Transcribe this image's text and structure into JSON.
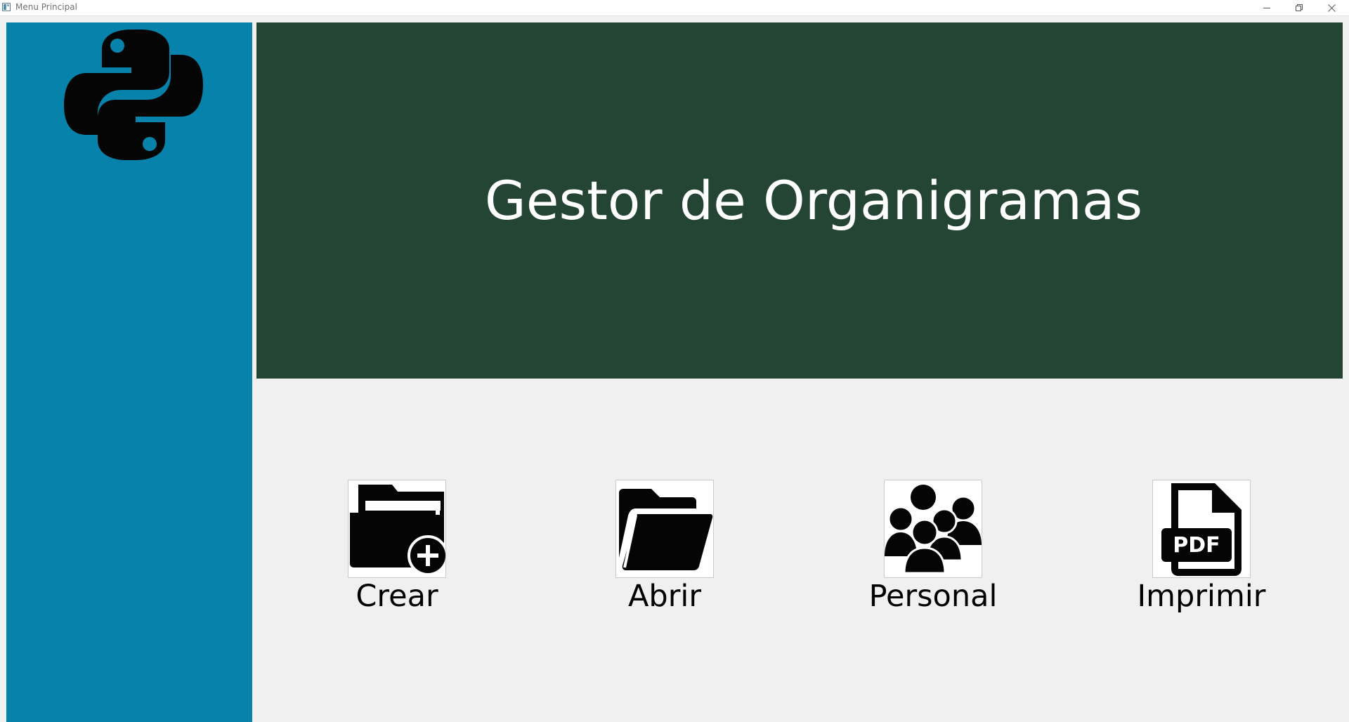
{
  "window": {
    "title": "Menu Principal",
    "controls": [
      "minimize-icon",
      "restore-icon",
      "close-icon"
    ]
  },
  "sidebar": {
    "logo": "python-logo-icon",
    "background": "#0783ab"
  },
  "header": {
    "title": "Gestor de Organigramas",
    "background": "#244434"
  },
  "actions": [
    {
      "label": "Crear",
      "icon": "new-folder-icon"
    },
    {
      "label": "Abrir",
      "icon": "open-folder-icon"
    },
    {
      "label": "Personal",
      "icon": "people-group-icon"
    },
    {
      "label": "Imprimir",
      "icon": "pdf-file-icon"
    }
  ]
}
